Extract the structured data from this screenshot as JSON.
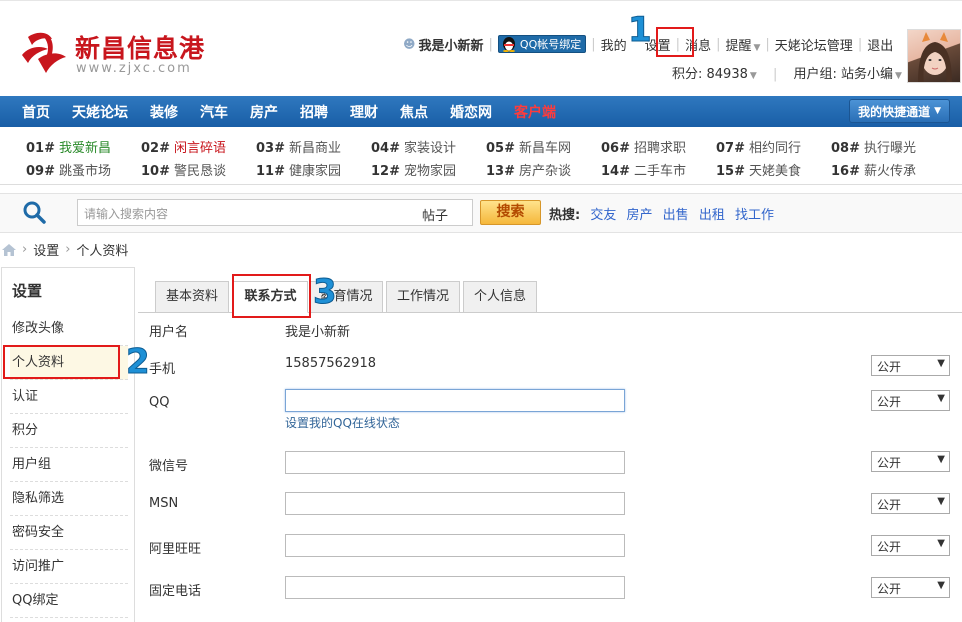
{
  "logo": {
    "name": "新昌信息港",
    "url": "www.zjxc.com"
  },
  "topbar": {
    "username": "我是小新新",
    "qq_bind": "QQ帐号绑定",
    "links": [
      "我的",
      "设置",
      "消息",
      "提醒",
      "天姥论坛管理",
      "退出"
    ],
    "points_label": "积分: 84938",
    "group_label": "用户组: 站务小编"
  },
  "nav": {
    "items": [
      "首页",
      "天姥论坛",
      "装修",
      "汽车",
      "房产",
      "招聘",
      "理财",
      "焦点",
      "婚恋网",
      "客户端"
    ],
    "quick": "我的快捷通道"
  },
  "forums": [
    {
      "num": "01#",
      "name": "我爱新昌",
      "color": "#2a8a2a"
    },
    {
      "num": "02#",
      "name": "闲言碎语",
      "color": "#c8161d"
    },
    {
      "num": "03#",
      "name": "新昌商业",
      "color": "#555555"
    },
    {
      "num": "04#",
      "name": "家装设计",
      "color": "#555555"
    },
    {
      "num": "05#",
      "name": "新昌车网",
      "color": "#555555"
    },
    {
      "num": "06#",
      "name": "招聘求职",
      "color": "#555555"
    },
    {
      "num": "07#",
      "name": "相约同行",
      "color": "#555555"
    },
    {
      "num": "08#",
      "name": "执行曝光",
      "color": "#555555"
    },
    {
      "num": "09#",
      "name": "跳蚤市场",
      "color": "#555555"
    },
    {
      "num": "10#",
      "name": "警民恳谈",
      "color": "#555555"
    },
    {
      "num": "11#",
      "name": "健康家园",
      "color": "#555555"
    },
    {
      "num": "12#",
      "name": "宠物家园",
      "color": "#555555"
    },
    {
      "num": "13#",
      "name": "房产杂谈",
      "color": "#555555"
    },
    {
      "num": "14#",
      "name": "二手车市",
      "color": "#555555"
    },
    {
      "num": "15#",
      "name": "天姥美食",
      "color": "#555555"
    },
    {
      "num": "16#",
      "name": "薪火传承",
      "color": "#555555"
    }
  ],
  "search": {
    "placeholder": "请输入搜索内容",
    "type": "帖子",
    "button": "搜索",
    "hot_label": "热搜:",
    "hot": [
      "交友",
      "房产",
      "出售",
      "出租",
      "找工作"
    ]
  },
  "breadcrumb": [
    "设置",
    "个人资料"
  ],
  "sidebar": {
    "title": "设置",
    "items": [
      "修改头像",
      "个人资料",
      "认证",
      "积分",
      "用户组",
      "隐私筛选",
      "密码安全",
      "访问推广",
      "QQ绑定"
    ]
  },
  "tabs": [
    "基本资料",
    "联系方式",
    "教育情况",
    "工作情况",
    "个人信息"
  ],
  "form": {
    "username_label": "用户名",
    "username_value": "我是小新新",
    "phone_label": "手机",
    "phone_value": "15857562918",
    "qq_label": "QQ",
    "qq_hint": "设置我的QQ在线状态",
    "wechat_label": "微信号",
    "msn_label": "MSN",
    "wangwang_label": "阿里旺旺",
    "tel_label": "固定电话",
    "privacy": "公开"
  },
  "annotations": [
    "1",
    "2",
    "3"
  ]
}
